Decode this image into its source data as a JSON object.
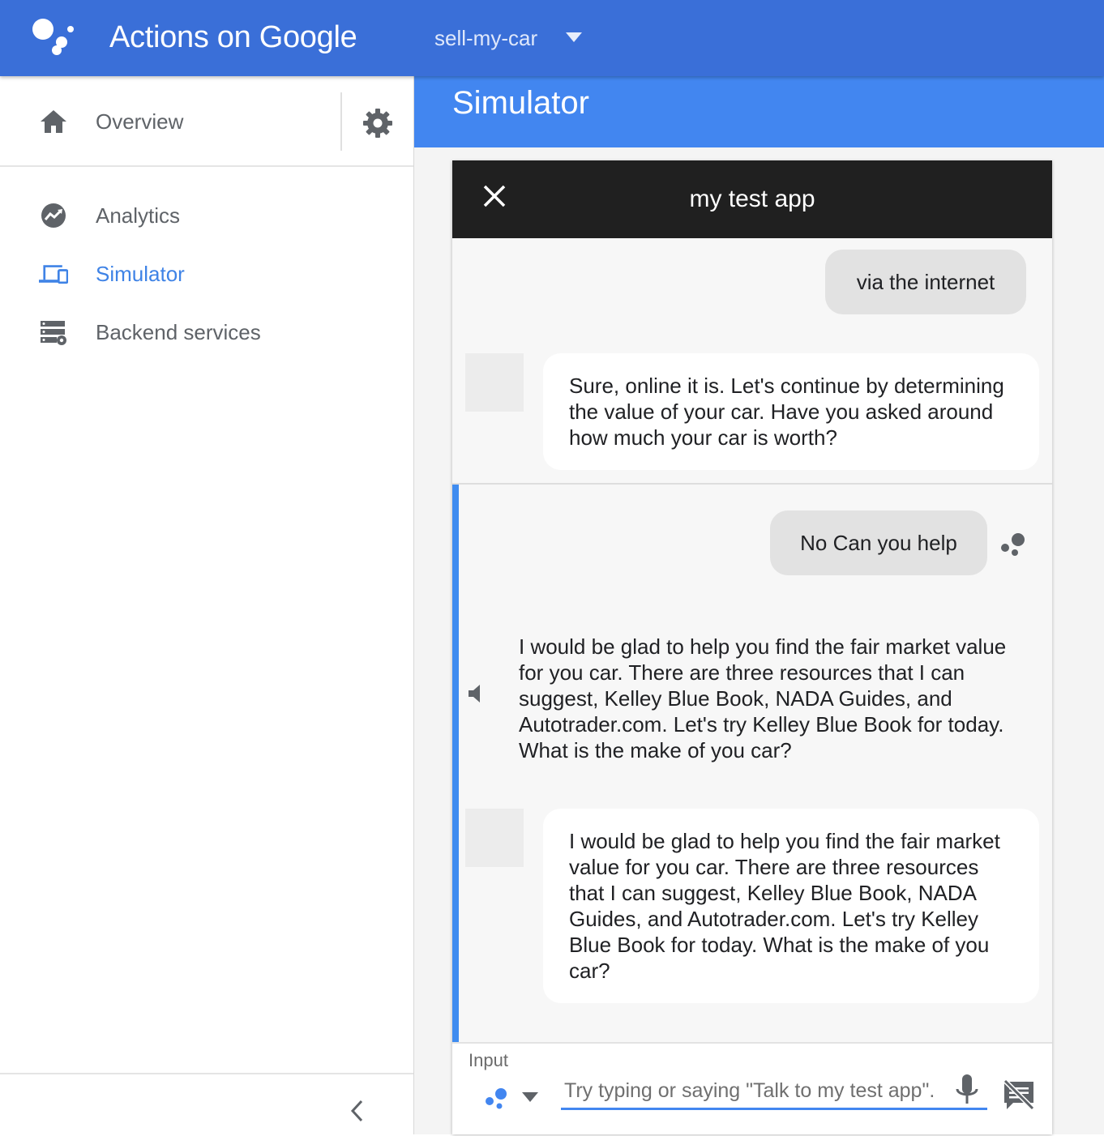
{
  "app": {
    "brand": "Actions on Google",
    "project": "sell-my-car"
  },
  "sidebar": {
    "header_item": "Overview",
    "items": [
      {
        "label": "Analytics",
        "icon": "trend-circle-icon",
        "active": false
      },
      {
        "label": "Simulator",
        "icon": "devices-icon",
        "active": true
      },
      {
        "label": "Backend services",
        "icon": "server-settings-icon",
        "active": false
      }
    ]
  },
  "main": {
    "title": "Simulator"
  },
  "simulator": {
    "app_title": "my test app",
    "messages": [
      {
        "role": "user",
        "text": "via the internet"
      },
      {
        "role": "bot",
        "text": "Sure, online it is. Let's continue by determining the value of your car. Have you asked around how much your car is worth?"
      },
      {
        "role": "user",
        "text": "No Can you help"
      },
      {
        "role": "speech",
        "text": "I would be glad to help you find the fair market value for you car. There are three resources that I can suggest, Kelley Blue Book, NADA Guides, and Autotrader.com. Let's try Kelley Blue Book for today. What is the make of you car?"
      },
      {
        "role": "bot",
        "text": "I would be glad to help you find the fair market value for you car. There are three resources that I can suggest, Kelley Blue Book, NADA Guides, and Autotrader.com. Let's try Kelley Blue Book for today. What is the make of you car?"
      }
    ],
    "input": {
      "label": "Input",
      "placeholder": "Try typing or saying \"Talk to my test app\".",
      "value": ""
    }
  },
  "colors": {
    "topbar": "#3a6fd8",
    "main_header": "#4286f0",
    "active_nav": "#3f83e6",
    "device_bar": "#202020"
  }
}
